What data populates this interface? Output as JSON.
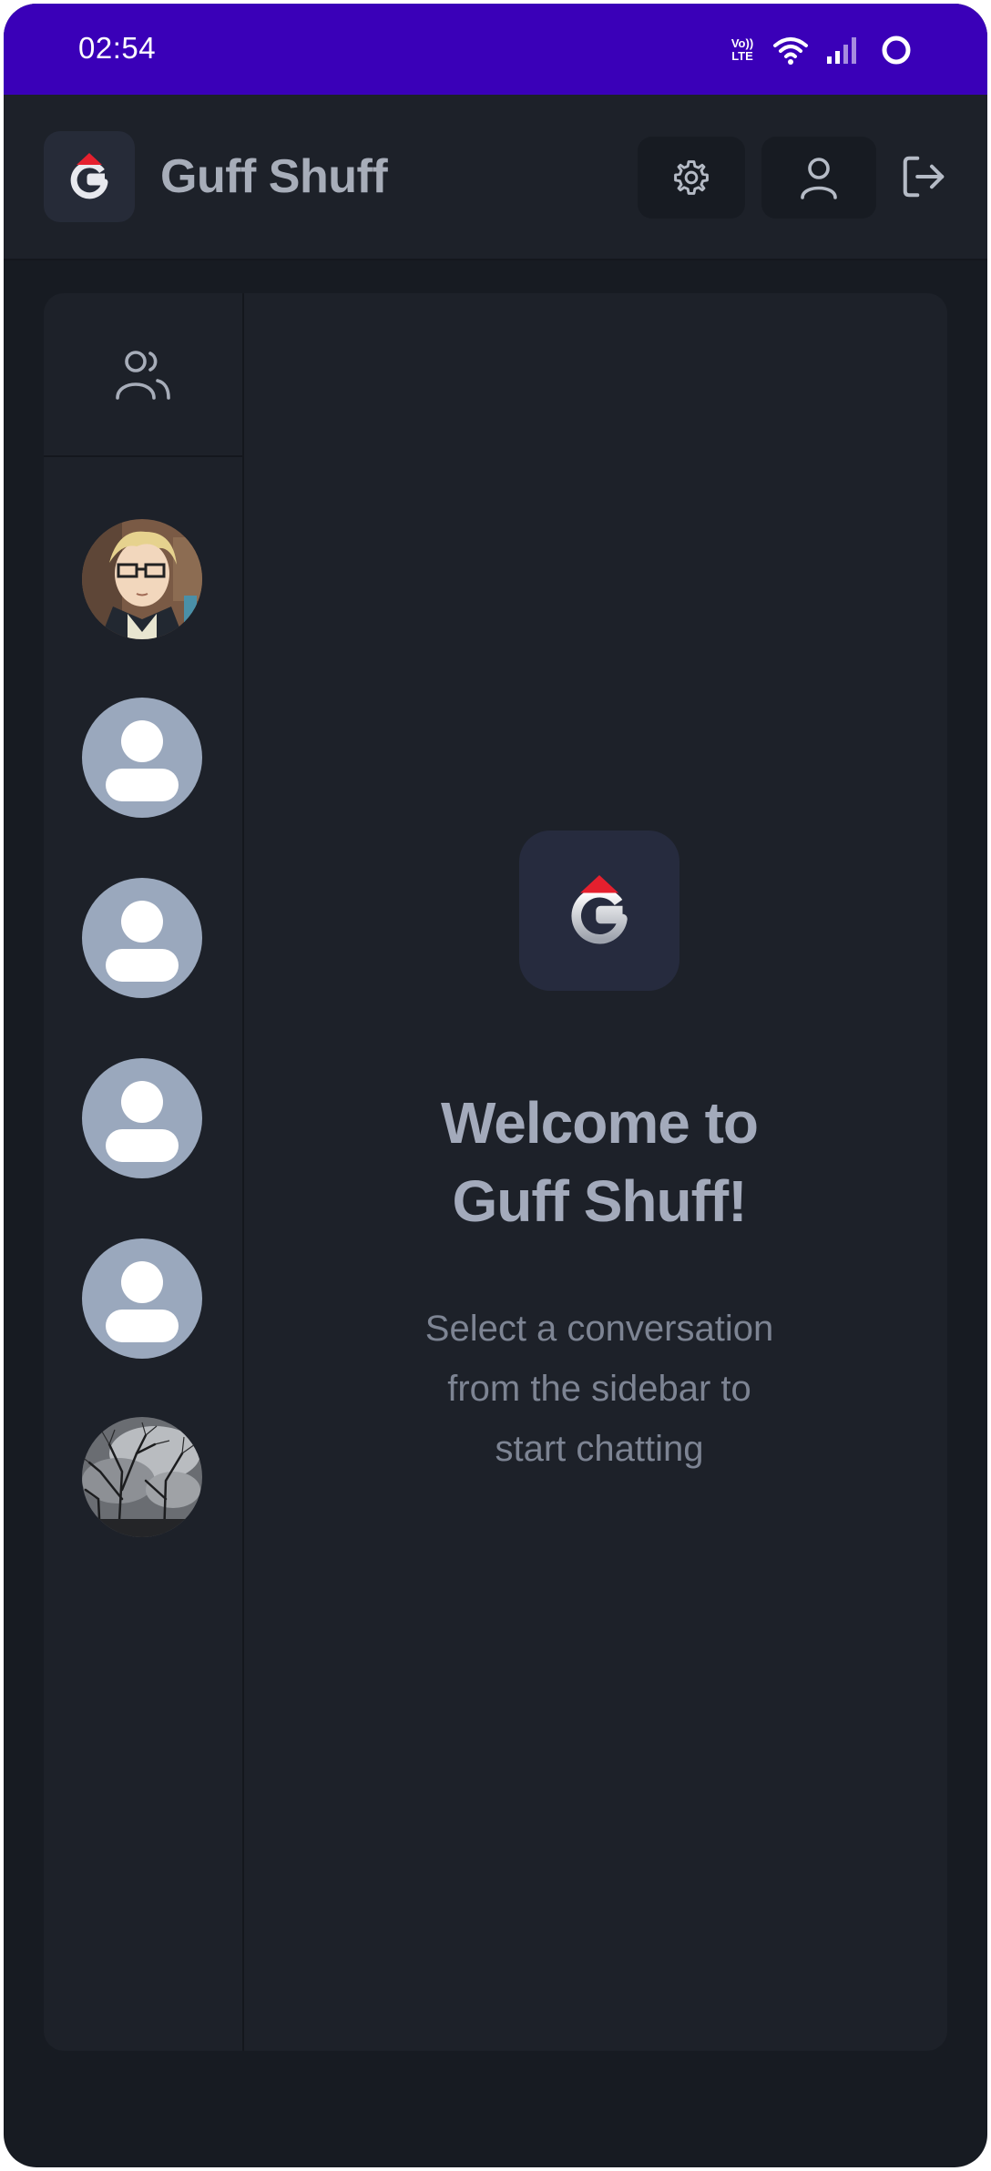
{
  "status_bar": {
    "time": "02:54",
    "volte_top": "Vo))",
    "volte_bottom": "LTE",
    "background": "#3a00b8",
    "icons": [
      "volte-icon",
      "wifi-icon",
      "cell-signal-icon",
      "sync-ring-icon"
    ]
  },
  "header": {
    "app_name": "Guff Shuff",
    "buttons": [
      "gear-icon",
      "user-icon",
      "logout-icon"
    ]
  },
  "sidebar": {
    "header_icon": "users-icon",
    "contacts": [
      {
        "avatar": "anime-character-photo"
      },
      {
        "avatar": "default-person-icon"
      },
      {
        "avatar": "default-person-icon"
      },
      {
        "avatar": "default-person-icon"
      },
      {
        "avatar": "default-person-icon"
      },
      {
        "avatar": "trees-sky-photo"
      }
    ]
  },
  "welcome": {
    "title_line1": "Welcome to",
    "title_line2": "Guff Shuff!",
    "subtitle_line1": "Select a conversation",
    "subtitle_line2": "from the sidebar to",
    "subtitle_line3": "start chatting"
  },
  "colors": {
    "accent_red": "#e5202e",
    "background": "#171b22",
    "panel": "#1d2129",
    "default_avatar": "#9aa8bd"
  }
}
